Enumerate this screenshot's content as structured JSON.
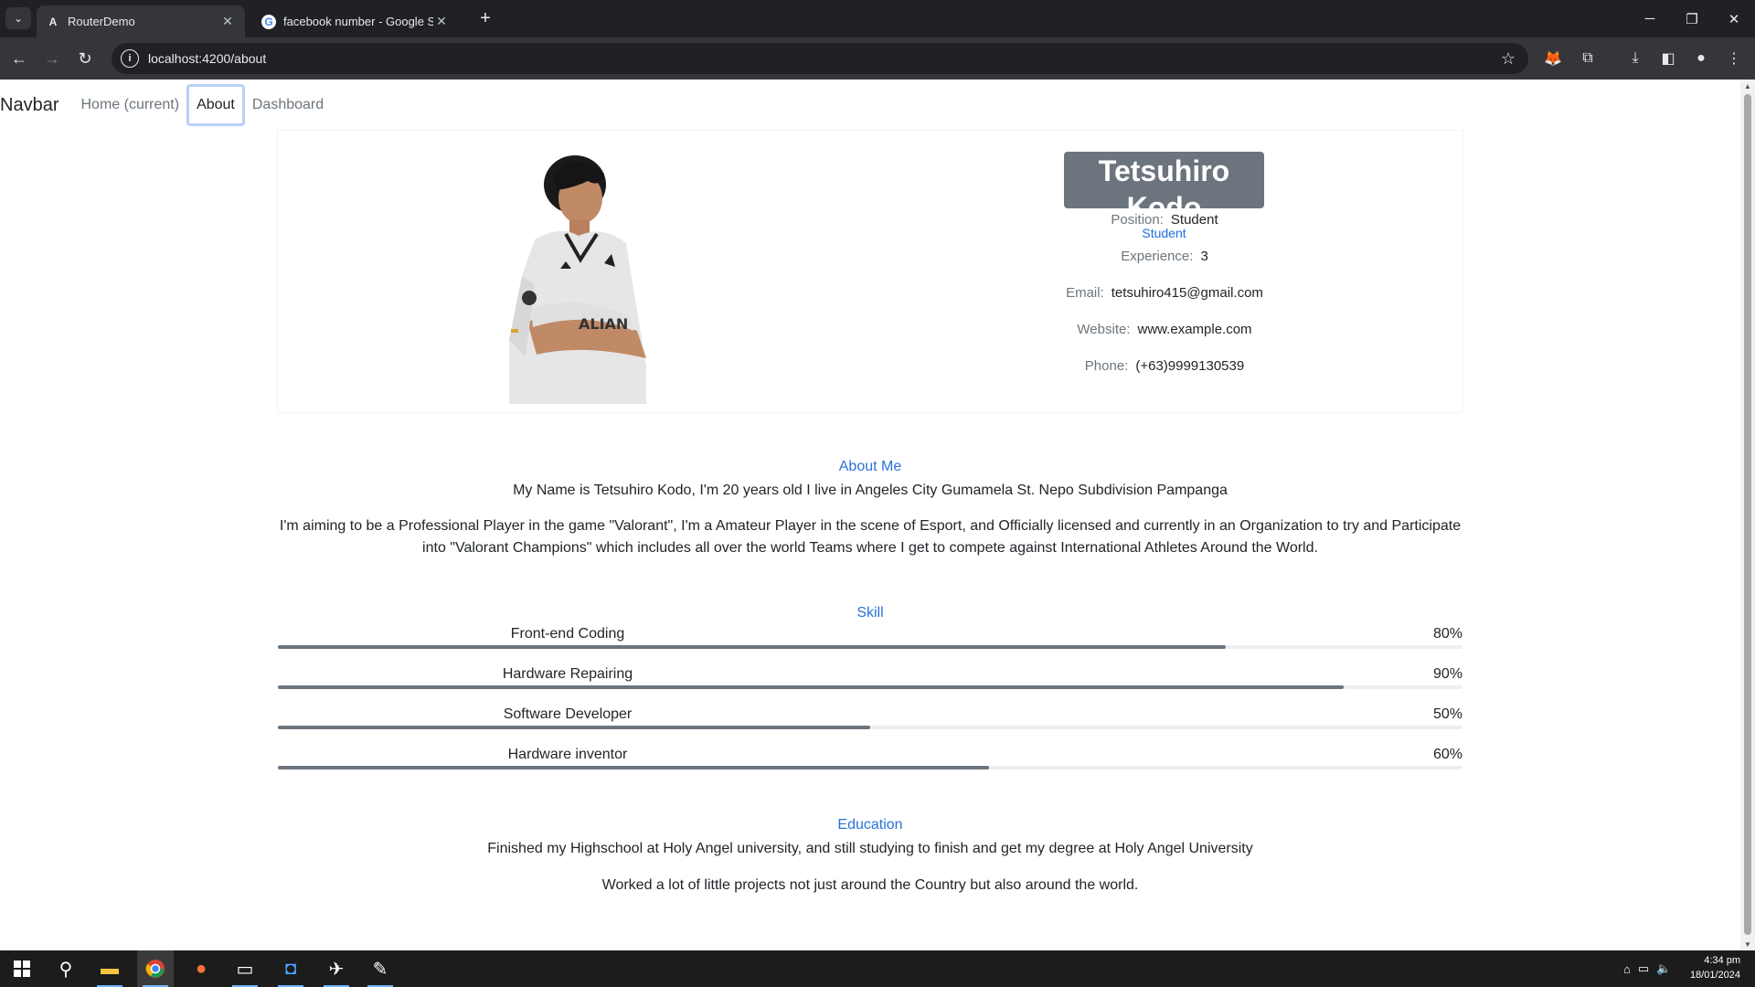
{
  "browser": {
    "tabs": [
      {
        "title": "RouterDemo",
        "favicon": "A",
        "active": true
      },
      {
        "title": "facebook number - Google Sea",
        "favicon": "G",
        "active": false
      }
    ],
    "url": "localhost:4200/about"
  },
  "navbar": {
    "brand": "Navbar",
    "links": [
      {
        "label": "Home (current)"
      },
      {
        "label": "About"
      },
      {
        "label": "Dashboard"
      }
    ]
  },
  "profile": {
    "name": "Tetsuhiro Kodo",
    "role": "Student",
    "fields": [
      {
        "label": "Position:",
        "value": "Student"
      },
      {
        "label": "Experience:",
        "value": "3"
      },
      {
        "label": "Email:",
        "value": "tetsuhiro415@gmail.com"
      },
      {
        "label": "Website:",
        "value": "www.example.com"
      },
      {
        "label": "Phone:",
        "value": "(+63)9999130539"
      }
    ]
  },
  "about": {
    "title": "About Me",
    "line1": "My Name is Tetsuhiro Kodo, I'm 20 years old I live in Angeles City Gumamela St. Nepo Subdivision Pampanga",
    "line2": "I'm aiming to be a Professional Player in the game \"Valorant\", I'm a Amateur Player in the scene of Esport, and Officially licensed and currently in an Organization to try and Participate into \"Valorant Champions\" which includes all over the world Teams where I get to compete against International Athletes Around the World."
  },
  "skills": {
    "title": "Skill",
    "items": [
      {
        "name": "Front-end Coding",
        "percent_label": "80%",
        "value": 80
      },
      {
        "name": "Hardware Repairing",
        "percent_label": "90%",
        "value": 90
      },
      {
        "name": "Software Developer",
        "percent_label": "50%",
        "value": 50
      },
      {
        "name": "Hardware inventor",
        "percent_label": "60%",
        "value": 60
      }
    ]
  },
  "education": {
    "title": "Education",
    "line1": "Finished my Highschool at Holy Angel university, and still studying to finish and get my degree at Holy Angel University",
    "line2": "Worked a lot of little projects not just around the Country but also around the world."
  },
  "taskbar": {
    "time": "4:34 pm",
    "date": "18/01/2024"
  }
}
